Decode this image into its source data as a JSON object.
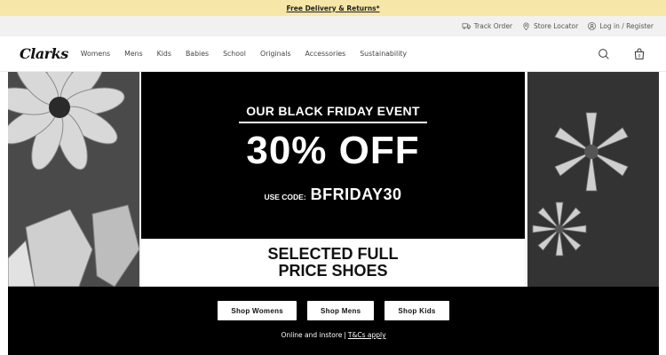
{
  "promo": {
    "text": "Free Delivery & Returns*"
  },
  "utility": {
    "track_order": "Track Order",
    "store_locator": "Store Locator",
    "login": "Log in / Register"
  },
  "nav": {
    "logo": "Clarks",
    "links": [
      "Womens",
      "Mens",
      "Kids",
      "Babies",
      "School",
      "Originals",
      "Accessories",
      "Sustainability"
    ]
  },
  "hero": {
    "event_title": "OUR BLACK FRIDAY EVENT",
    "discount": "30% OFF",
    "code_label": "USE CODE:",
    "code_value": "BFRIDAY30",
    "selected_line1": "SELECTED FULL",
    "selected_line2": "PRICE SHOES"
  },
  "cta": {
    "buttons": [
      "Shop Womens",
      "Shop Mens",
      "Shop Kids"
    ],
    "note": "Online and instore",
    "separator": "|",
    "tc_link": "T&Cs apply"
  },
  "colors": {
    "promo_bg": "#f6e7a9",
    "util_bg": "#f1f1f1",
    "hero_black": "#000000",
    "cta_bg": "#000000"
  }
}
